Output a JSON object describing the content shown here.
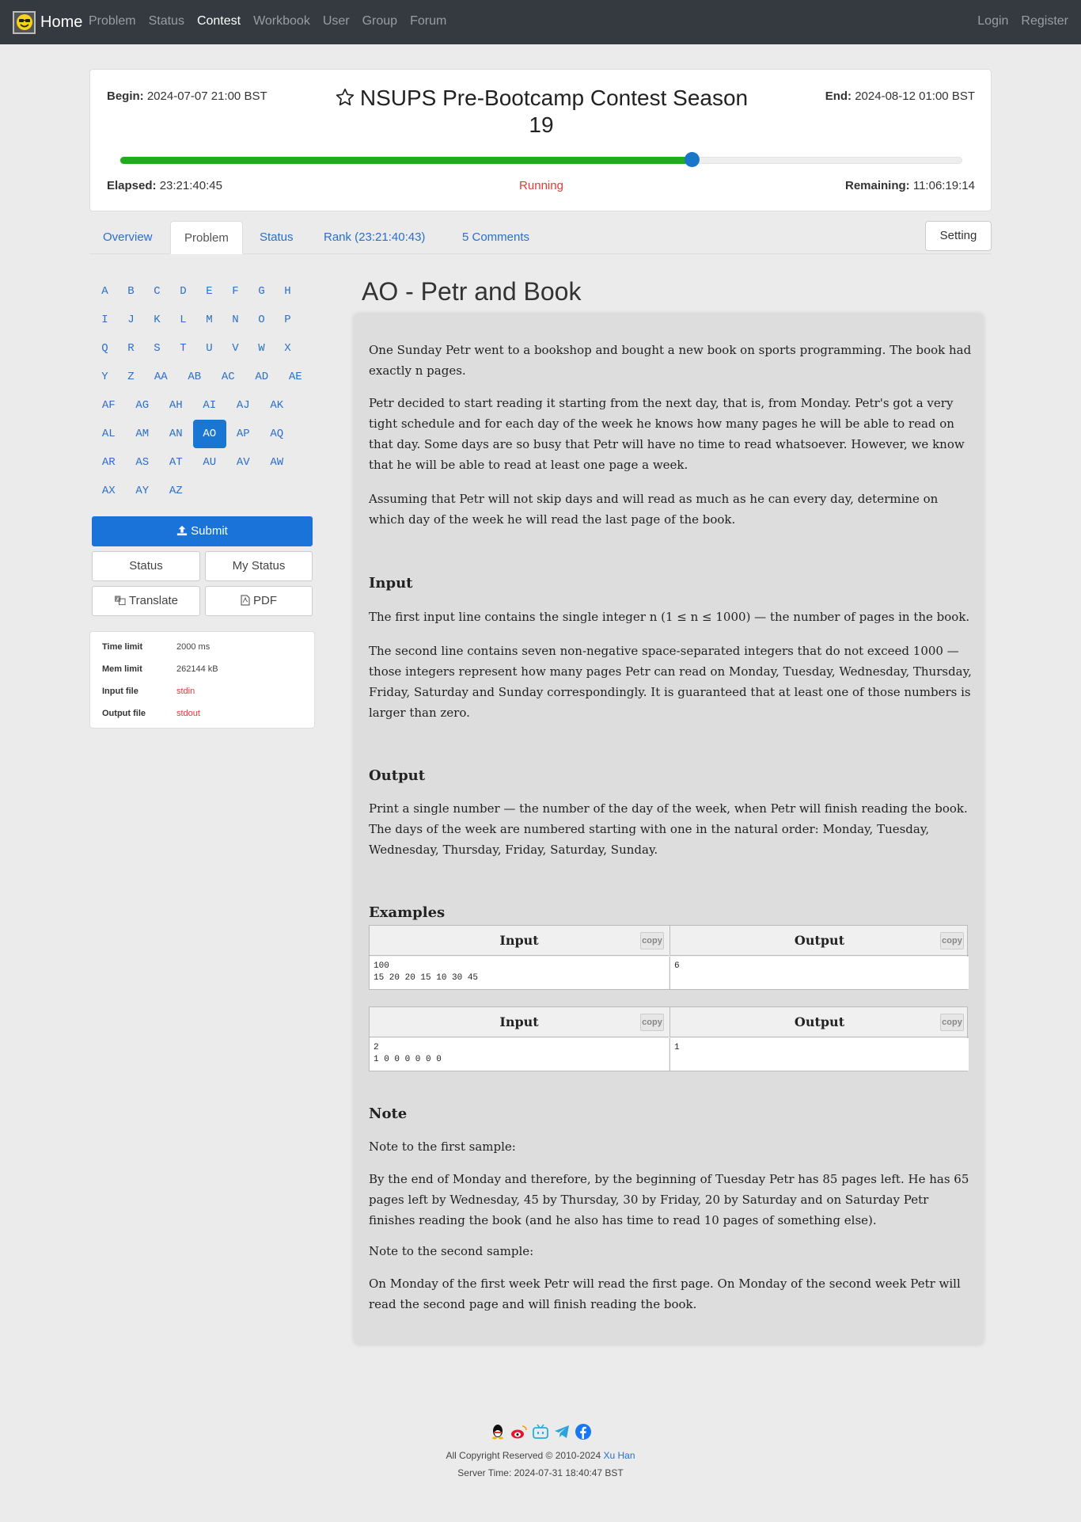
{
  "nav": {
    "brand": "Home",
    "links": [
      "Problem",
      "Status",
      "Contest",
      "Workbook",
      "User",
      "Group",
      "Forum"
    ],
    "active": "Contest",
    "right": [
      "Login",
      "Register"
    ]
  },
  "contest": {
    "begin_label": "Begin:",
    "begin": "2024-07-07 21:00 BST",
    "end_label": "End:",
    "end": "2024-08-12 01:00 BST",
    "title": "NSUPS Pre-Bootcamp Contest Season 19",
    "elapsed_label": "Elapsed:",
    "elapsed": "23:21:40:45",
    "status": "Running",
    "remaining_label": "Remaining:",
    "remaining": "11:06:19:14",
    "progress_fraction": 0.68,
    "colors": {
      "progress": "#1dad1d",
      "knob": "#1976c8",
      "status": "#e53935"
    }
  },
  "tabs": {
    "overview": "Overview",
    "problem": "Problem",
    "status": "Status",
    "rank": "Rank (23:21:40:43)",
    "comments": "5 Comments",
    "setting": "Setting"
  },
  "problems": [
    "A",
    "B",
    "C",
    "D",
    "E",
    "F",
    "G",
    "H",
    "I",
    "J",
    "K",
    "L",
    "M",
    "N",
    "O",
    "P",
    "Q",
    "R",
    "S",
    "T",
    "U",
    "V",
    "W",
    "X",
    "Y",
    "Z",
    "AA",
    "AB",
    "AC",
    "AD",
    "AE",
    "AF",
    "AG",
    "AH",
    "AI",
    "AJ",
    "AK",
    "AL",
    "AM",
    "AN",
    "AO",
    "AP",
    "AQ",
    "AR",
    "AS",
    "AT",
    "AU",
    "AV",
    "AW",
    "AX",
    "AY",
    "AZ"
  ],
  "active_problem": "AO",
  "side": {
    "submit": "Submit",
    "status": "Status",
    "my_status": "My Status",
    "translate": "Translate",
    "pdf": "PDF",
    "time_limit_label": "Time limit",
    "time_limit": "2000 ms",
    "mem_limit_label": "Mem limit",
    "mem_limit": "262144 kB",
    "input_file_label": "Input file",
    "input_file": "stdin",
    "output_file_label": "Output file",
    "output_file": "stdout"
  },
  "problem": {
    "title": "AO - Petr and Book",
    "p1": "One Sunday Petr went to a bookshop and bought a new book on sports programming. The book had exactly n pages.",
    "p2": "Petr decided to start reading it starting from the next day, that is, from Monday. Petr's got a very tight schedule and for each day of the week he knows how many pages he will be able to read on that day. Some days are so busy that Petr will have no time to read whatsoever. However, we know that he will be able to read at least one page a week.",
    "p3": "Assuming that Petr will not skip days and will read as much as he can every day, determine on which day of the week he will read the last page of the book.",
    "input_h": "Input",
    "input_p1": "The first input line contains the single integer n (1 ≤ n ≤ 1000) — the number of pages in the book.",
    "input_p2": "The second line contains seven non-negative space-separated integers that do not exceed 1000 — those integers represent how many pages Petr can read on Monday, Tuesday, Wednesday, Thursday, Friday, Saturday and Sunday correspondingly. It is guaranteed that at least one of those numbers is larger than zero.",
    "output_h": "Output",
    "output_p": "Print a single number — the number of the day of the week, when Petr will finish reading the book. The days of the week are numbered starting with one in the natural order: Monday, Tuesday, Wednesday, Thursday, Friday, Saturday, Sunday.",
    "examples_h": "Examples",
    "col_input": "Input",
    "col_output": "Output",
    "copy": "copy",
    "ex1_in": "100\n15 20 20 15 10 30 45",
    "ex1_out": "6",
    "ex2_in": "2\n1 0 0 0 0 0 0",
    "ex2_out": "1",
    "note_h": "Note",
    "note1": "Note to the first sample:",
    "note2": "By the end of Monday and therefore, by the beginning of Tuesday Petr has 85 pages left. He has 65 pages left by Wednesday, 45 by Thursday, 30 by Friday, 20 by Saturday and on Saturday Petr finishes reading the book (and he also has time to read 10 pages of something else).",
    "note3": "Note to the second sample:",
    "note4": "On Monday of the first week Petr will read the first page. On Monday of the second week Petr will read the second page and will finish reading the book."
  },
  "footer": {
    "icons": [
      "qq-icon",
      "weibo-icon",
      "bilibili-icon",
      "telegram-icon",
      "facebook-icon"
    ],
    "copyright": "All Copyright Reserved © 2010-2024",
    "author": "Xu Han",
    "server_time": "Server Time: 2024-07-31 18:40:47 BST"
  }
}
